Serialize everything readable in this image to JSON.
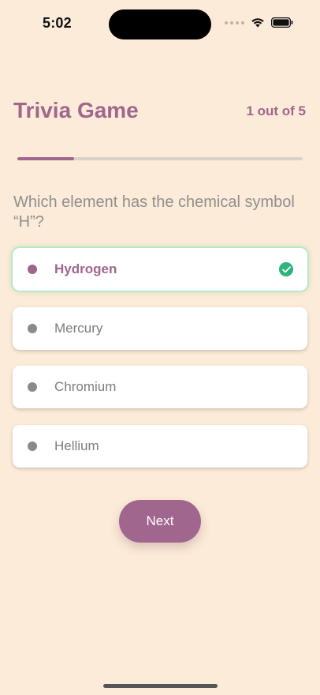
{
  "status_bar": {
    "time": "5:02",
    "icons": [
      "signal-dots-icon",
      "wifi-icon",
      "battery-icon"
    ]
  },
  "header": {
    "title": "Trivia Game",
    "progress_text": "1 out of 5",
    "progress_fraction": 0.2
  },
  "question": "Which element has the chemical symbol “H”?",
  "options": [
    {
      "label": "Hydrogen",
      "selected": true
    },
    {
      "label": "Mercury",
      "selected": false
    },
    {
      "label": "Chromium",
      "selected": false
    },
    {
      "label": "Hellium",
      "selected": false
    }
  ],
  "next_label": "Next",
  "colors": {
    "background": "#fcebd8",
    "accent": "#a0668e",
    "correct": "#2fb37c"
  }
}
